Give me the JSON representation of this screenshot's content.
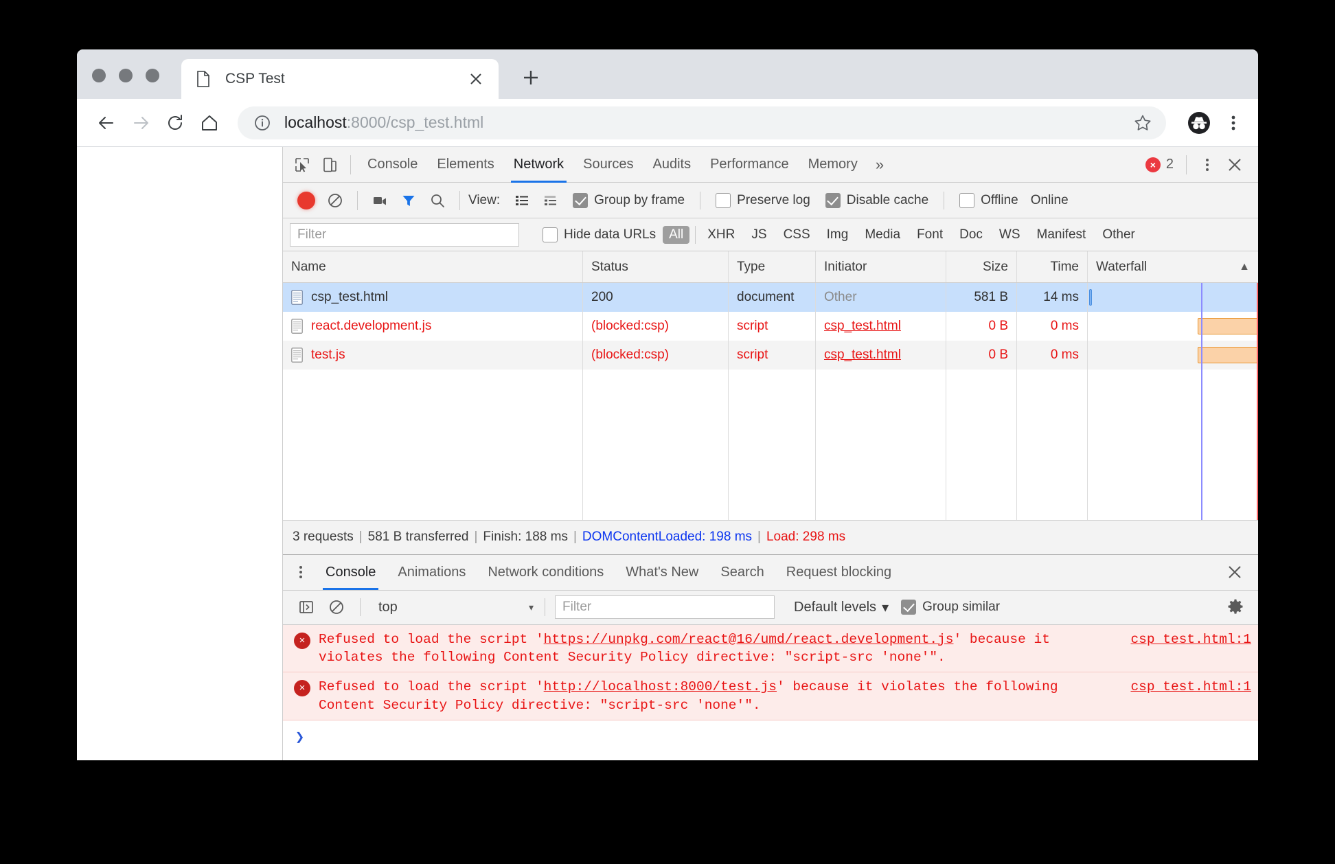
{
  "browser": {
    "tab": {
      "title": "CSP Test",
      "favicon": "document-icon",
      "close": "×"
    },
    "newtab_label": "+",
    "omnibox": {
      "url_host": "localhost",
      "url_rest": ":8000/csp_test.html",
      "info_icon": "info-circle-icon",
      "star_icon": "bookmark-star-icon",
      "profile_icon": "incognito-icon",
      "menu_icon": "three-dot-menu-icon"
    },
    "nav": {
      "back": "back-arrow-icon",
      "forward": "forward-arrow-icon",
      "reload": "reload-icon",
      "home": "home-icon"
    }
  },
  "devtools": {
    "tabs": [
      {
        "label": "Console",
        "active": false
      },
      {
        "label": "Elements",
        "active": false
      },
      {
        "label": "Network",
        "active": true
      },
      {
        "label": "Sources",
        "active": false
      },
      {
        "label": "Audits",
        "active": false
      },
      {
        "label": "Performance",
        "active": false
      },
      {
        "label": "Memory",
        "active": false
      }
    ],
    "overflow_label": "»",
    "error_badge": {
      "icon": "×",
      "count": "2"
    },
    "more_icon": "three-dot-menu-icon",
    "close_icon": "close-icon",
    "inspect_icon": "inspect-element-icon",
    "device_icon": "device-toolbar-icon"
  },
  "network_toolbar": {
    "record_title": "record-button",
    "clear_title": "clear-icon",
    "capture_screenshots": "camera-icon",
    "filter_icon": "funnel-icon",
    "search_icon": "search-icon",
    "view_label": "View:",
    "view_list_icon": "list-view-icon",
    "view_waterfall_icon": "waterfall-view-icon",
    "group_by_frame": {
      "label": "Group by frame",
      "checked": true
    },
    "preserve_log": {
      "label": "Preserve log",
      "checked": false
    },
    "disable_cache": {
      "label": "Disable cache",
      "checked": true
    },
    "offline": {
      "label": "Offline",
      "checked": false
    },
    "online_label": "Online"
  },
  "filter_row": {
    "filter_placeholder": "Filter",
    "filter_value": "",
    "hide_data_urls": {
      "label": "Hide data URLs",
      "checked": false
    },
    "types": [
      {
        "label": "All",
        "active": true
      },
      {
        "label": "XHR",
        "active": false
      },
      {
        "label": "JS",
        "active": false
      },
      {
        "label": "CSS",
        "active": false
      },
      {
        "label": "Img",
        "active": false
      },
      {
        "label": "Media",
        "active": false
      },
      {
        "label": "Font",
        "active": false
      },
      {
        "label": "Doc",
        "active": false
      },
      {
        "label": "WS",
        "active": false
      },
      {
        "label": "Manifest",
        "active": false
      },
      {
        "label": "Other",
        "active": false
      }
    ]
  },
  "network_table": {
    "columns": [
      "Name",
      "Status",
      "Type",
      "Initiator",
      "Size",
      "Time",
      "Waterfall"
    ],
    "sort_indicator": "▲",
    "rows": [
      {
        "name": "csp_test.html",
        "status": "200",
        "type": "document",
        "initiator": "Other",
        "initiator_is_link": false,
        "size": "581 B",
        "time": "14 ms",
        "error": false,
        "selected": true,
        "bar_left_pct": 1,
        "bar_width_pct": 2.2,
        "bar_color": "blue"
      },
      {
        "name": "react.development.js",
        "status": "(blocked:csp)",
        "type": "script",
        "initiator": "csp_test.html",
        "initiator_is_link": true,
        "size": "0 B",
        "time": "0 ms",
        "error": true,
        "selected": false,
        "bar_left_pct": 67,
        "bar_width_pct": 34,
        "bar_color": "orange"
      },
      {
        "name": "test.js",
        "status": "(blocked:csp)",
        "type": "script",
        "initiator": "csp_test.html",
        "initiator_is_link": true,
        "size": "0 B",
        "time": "0 ms",
        "error": true,
        "selected": false,
        "bar_left_pct": 67,
        "bar_width_pct": 34,
        "bar_color": "orange"
      }
    ]
  },
  "network_status": {
    "requests": "3 requests",
    "transferred": "581 B transferred",
    "finish": "Finish: 188 ms",
    "dom_content_loaded": "DOMContentLoaded: 198 ms",
    "load": "Load: 298 ms",
    "separator": "|"
  },
  "drawer": {
    "menu_icon": "three-dot-menu-icon",
    "tabs": [
      {
        "label": "Console",
        "active": true
      },
      {
        "label": "Animations",
        "active": false
      },
      {
        "label": "Network conditions",
        "active": false
      },
      {
        "label": "What's New",
        "active": false
      },
      {
        "label": "Search",
        "active": false
      },
      {
        "label": "Request blocking",
        "active": false
      }
    ],
    "close_icon": "close-icon",
    "console_toolbar": {
      "sidebar_icon": "show-console-sidebar-icon",
      "clear_icon": "clear-console-icon",
      "context": "top",
      "context_caret": "▾",
      "filter_placeholder": "Filter",
      "filter_value": "",
      "levels": "Default levels",
      "levels_caret": "▾",
      "group_similar": {
        "label": "Group similar",
        "checked": true
      },
      "settings_icon": "gear-icon"
    },
    "messages": [
      {
        "icon": "×",
        "prefix": "Refused to load the script '",
        "link": "https://unpkg.com/react@16/umd/react.development.js",
        "suffix": "' because it violates the following Content Security Policy directive: \"script-src 'none'\".",
        "source": "csp_test.html:1"
      },
      {
        "icon": "×",
        "prefix": "Refused to load the script '",
        "link": "http://localhost:8000/test.js",
        "suffix": "' because it violates the following Content Security Policy directive: \"script-src 'none'\".",
        "source": "csp_test.html:1"
      }
    ],
    "prompt_arrow": "❯"
  },
  "colors": {
    "accent": "#1a73e8",
    "error": "#e81414",
    "error_bg": "#fdecea",
    "selected_row": "#c7dffc",
    "dcl": "#0b35f0",
    "waterfall_orange": "#fbd2a8",
    "waterfall_blue": "#7fb3f2"
  }
}
